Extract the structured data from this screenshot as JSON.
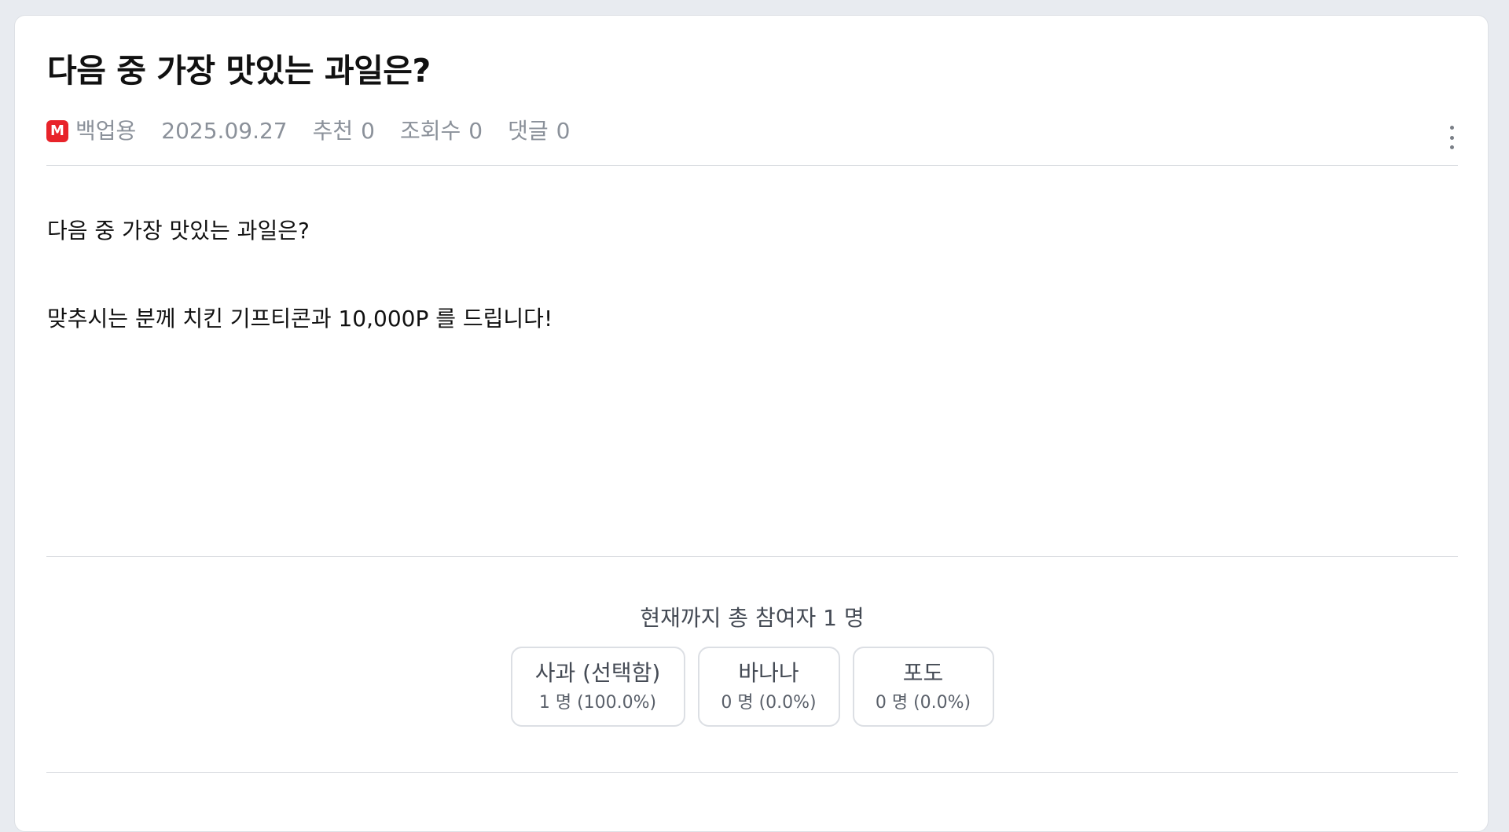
{
  "post": {
    "title": "다음 중 가장 맛있는 과일은?",
    "author_badge": "M",
    "author": "백업용",
    "date": "2025.09.27",
    "recommend_label": "추천",
    "recommend_count": "0",
    "views_label": "조회수",
    "views_count": "0",
    "comments_label": "댓글",
    "comments_count": "0",
    "body_line1": "다음 중 가장 맛있는 과일은?",
    "body_line2": "맞추시는 분께 치킨 기프티콘과 10,000P 를 드립니다!"
  },
  "poll": {
    "total_text": "현재까지 총 참여자 1 명",
    "options": [
      {
        "label": "사과 (선택함)",
        "result": "1 명 (100.0%)"
      },
      {
        "label": "바나나",
        "result": "0 명 (0.0%)"
      },
      {
        "label": "포도",
        "result": "0 명 (0.0%)"
      }
    ]
  },
  "icons": {
    "badge": "m-badge-icon",
    "more": "more-vertical-icon"
  },
  "colors": {
    "badge": "#e8232a",
    "background": "#e8ebf0",
    "meta_text": "#8b919a"
  }
}
